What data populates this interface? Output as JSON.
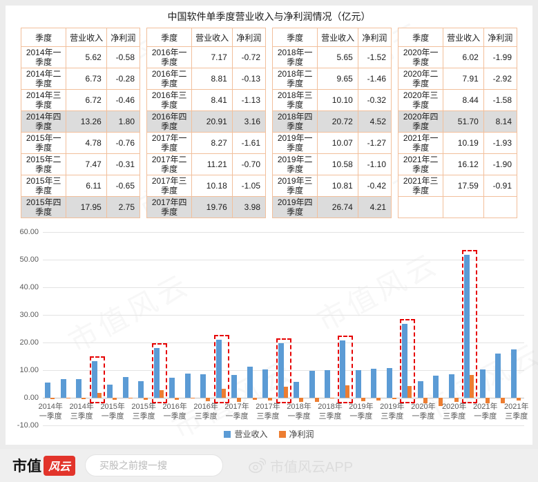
{
  "title": "中国软件单季度营业收入与净利润情况（亿元）",
  "watermark_text": "市值风云",
  "tables": {
    "headers": [
      "季度",
      "营业收入",
      "净利润"
    ],
    "groups": [
      {
        "rows": [
          {
            "q": "2014年一季度",
            "rev": "5.62",
            "np": "-0.58",
            "hl": false
          },
          {
            "q": "2014年二季度",
            "rev": "6.73",
            "np": "-0.28",
            "hl": false
          },
          {
            "q": "2014年三季度",
            "rev": "6.72",
            "np": "-0.46",
            "hl": false
          },
          {
            "q": "2014年四季度",
            "rev": "13.26",
            "np": "1.80",
            "hl": true
          },
          {
            "q": "2015年一季度",
            "rev": "4.78",
            "np": "-0.76",
            "hl": false
          },
          {
            "q": "2015年二季度",
            "rev": "7.47",
            "np": "-0.31",
            "hl": false
          },
          {
            "q": "2015年三季度",
            "rev": "6.11",
            "np": "-0.65",
            "hl": false
          },
          {
            "q": "2015年四季度",
            "rev": "17.95",
            "np": "2.75",
            "hl": true
          }
        ]
      },
      {
        "rows": [
          {
            "q": "2016年一季度",
            "rev": "7.17",
            "np": "-0.72",
            "hl": false
          },
          {
            "q": "2016年二季度",
            "rev": "8.81",
            "np": "-0.13",
            "hl": false
          },
          {
            "q": "2016年三季度",
            "rev": "8.41",
            "np": "-1.13",
            "hl": false
          },
          {
            "q": "2016年四季度",
            "rev": "20.91",
            "np": "3.16",
            "hl": true
          },
          {
            "q": "2017年一季度",
            "rev": "8.27",
            "np": "-1.61",
            "hl": false
          },
          {
            "q": "2017年二季度",
            "rev": "11.21",
            "np": "-0.70",
            "hl": false
          },
          {
            "q": "2017年三季度",
            "rev": "10.18",
            "np": "-1.05",
            "hl": false
          },
          {
            "q": "2017年四季度",
            "rev": "19.76",
            "np": "3.98",
            "hl": true
          }
        ]
      },
      {
        "rows": [
          {
            "q": "2018年一季度",
            "rev": "5.65",
            "np": "-1.52",
            "hl": false
          },
          {
            "q": "2018年二季度",
            "rev": "9.65",
            "np": "-1.46",
            "hl": false
          },
          {
            "q": "2018年三季度",
            "rev": "10.10",
            "np": "-0.32",
            "hl": false
          },
          {
            "q": "2018年四季度",
            "rev": "20.72",
            "np": "4.52",
            "hl": true
          },
          {
            "q": "2019年一季度",
            "rev": "10.07",
            "np": "-1.27",
            "hl": false
          },
          {
            "q": "2019年二季度",
            "rev": "10.58",
            "np": "-1.10",
            "hl": false
          },
          {
            "q": "2019年三季度",
            "rev": "10.81",
            "np": "-0.42",
            "hl": false
          },
          {
            "q": "2019年四季度",
            "rev": "26.74",
            "np": "4.21",
            "hl": true
          }
        ]
      },
      {
        "rows": [
          {
            "q": "2020年一季度",
            "rev": "6.02",
            "np": "-1.99",
            "hl": false
          },
          {
            "q": "2020年二季度",
            "rev": "7.91",
            "np": "-2.92",
            "hl": false
          },
          {
            "q": "2020年三季度",
            "rev": "8.44",
            "np": "-1.58",
            "hl": false
          },
          {
            "q": "2020年四季度",
            "rev": "51.70",
            "np": "8.14",
            "hl": true
          },
          {
            "q": "2021年一季度",
            "rev": "10.19",
            "np": "-1.93",
            "hl": false
          },
          {
            "q": "2021年二季度",
            "rev": "16.12",
            "np": "-1.90",
            "hl": false
          },
          {
            "q": "2021年三季度",
            "rev": "17.59",
            "np": "-0.91",
            "hl": false
          },
          {
            "q": "",
            "rev": "",
            "np": "",
            "hl": false
          }
        ]
      }
    ]
  },
  "chart_data": {
    "type": "bar",
    "title": "中国软件单季度营业收入与净利润情况（亿元）",
    "categories": [
      "2014年一季度",
      "2014年二季度",
      "2014年三季度",
      "2014年四季度",
      "2015年一季度",
      "2015年二季度",
      "2015年三季度",
      "2015年四季度",
      "2016年一季度",
      "2016年二季度",
      "2016年三季度",
      "2016年四季度",
      "2017年一季度",
      "2017年二季度",
      "2017年三季度",
      "2017年四季度",
      "2018年一季度",
      "2018年二季度",
      "2018年三季度",
      "2018年四季度",
      "2019年一季度",
      "2019年二季度",
      "2019年三季度",
      "2019年四季度",
      "2020年一季度",
      "2020年二季度",
      "2020年三季度",
      "2020年四季度",
      "2021年一季度",
      "2021年二季度",
      "2021年三季度"
    ],
    "series": [
      {
        "name": "营业收入",
        "color": "#5B9BD5",
        "values": [
          5.62,
          6.73,
          6.72,
          13.26,
          4.78,
          7.47,
          6.11,
          17.95,
          7.17,
          8.81,
          8.41,
          20.91,
          8.27,
          11.21,
          10.18,
          19.76,
          5.65,
          9.65,
          10.1,
          20.72,
          10.07,
          10.58,
          10.81,
          26.74,
          6.02,
          7.91,
          8.44,
          51.7,
          10.19,
          16.12,
          17.59
        ]
      },
      {
        "name": "净利润",
        "color": "#ED7D31",
        "values": [
          -0.58,
          -0.28,
          -0.46,
          1.8,
          -0.76,
          -0.31,
          -0.65,
          2.75,
          -0.72,
          -0.13,
          -1.13,
          3.16,
          -1.61,
          -0.7,
          -1.05,
          3.98,
          -1.52,
          -1.46,
          -0.32,
          4.52,
          -1.27,
          -1.1,
          -0.42,
          4.21,
          -1.99,
          -2.92,
          -1.58,
          8.14,
          -1.93,
          -1.9,
          -0.91
        ]
      }
    ],
    "ylim": [
      -10,
      60
    ],
    "ytick_step": 10,
    "ytick_labels": [
      "60.00",
      "50.00",
      "40.00",
      "30.00",
      "20.00",
      "10.00",
      "0.00",
      "-10.00"
    ],
    "xtick_every": 2,
    "grid": true,
    "legend_position": "bottom",
    "highlight_indices": [
      3,
      7,
      11,
      15,
      19,
      23,
      27
    ],
    "highlight_color": "#e60000"
  },
  "footer": {
    "brand_prefix": "市值",
    "brand_badge": "风云",
    "search_placeholder": "买股之前搜一搜",
    "watermark_app": "市值风云APP"
  }
}
